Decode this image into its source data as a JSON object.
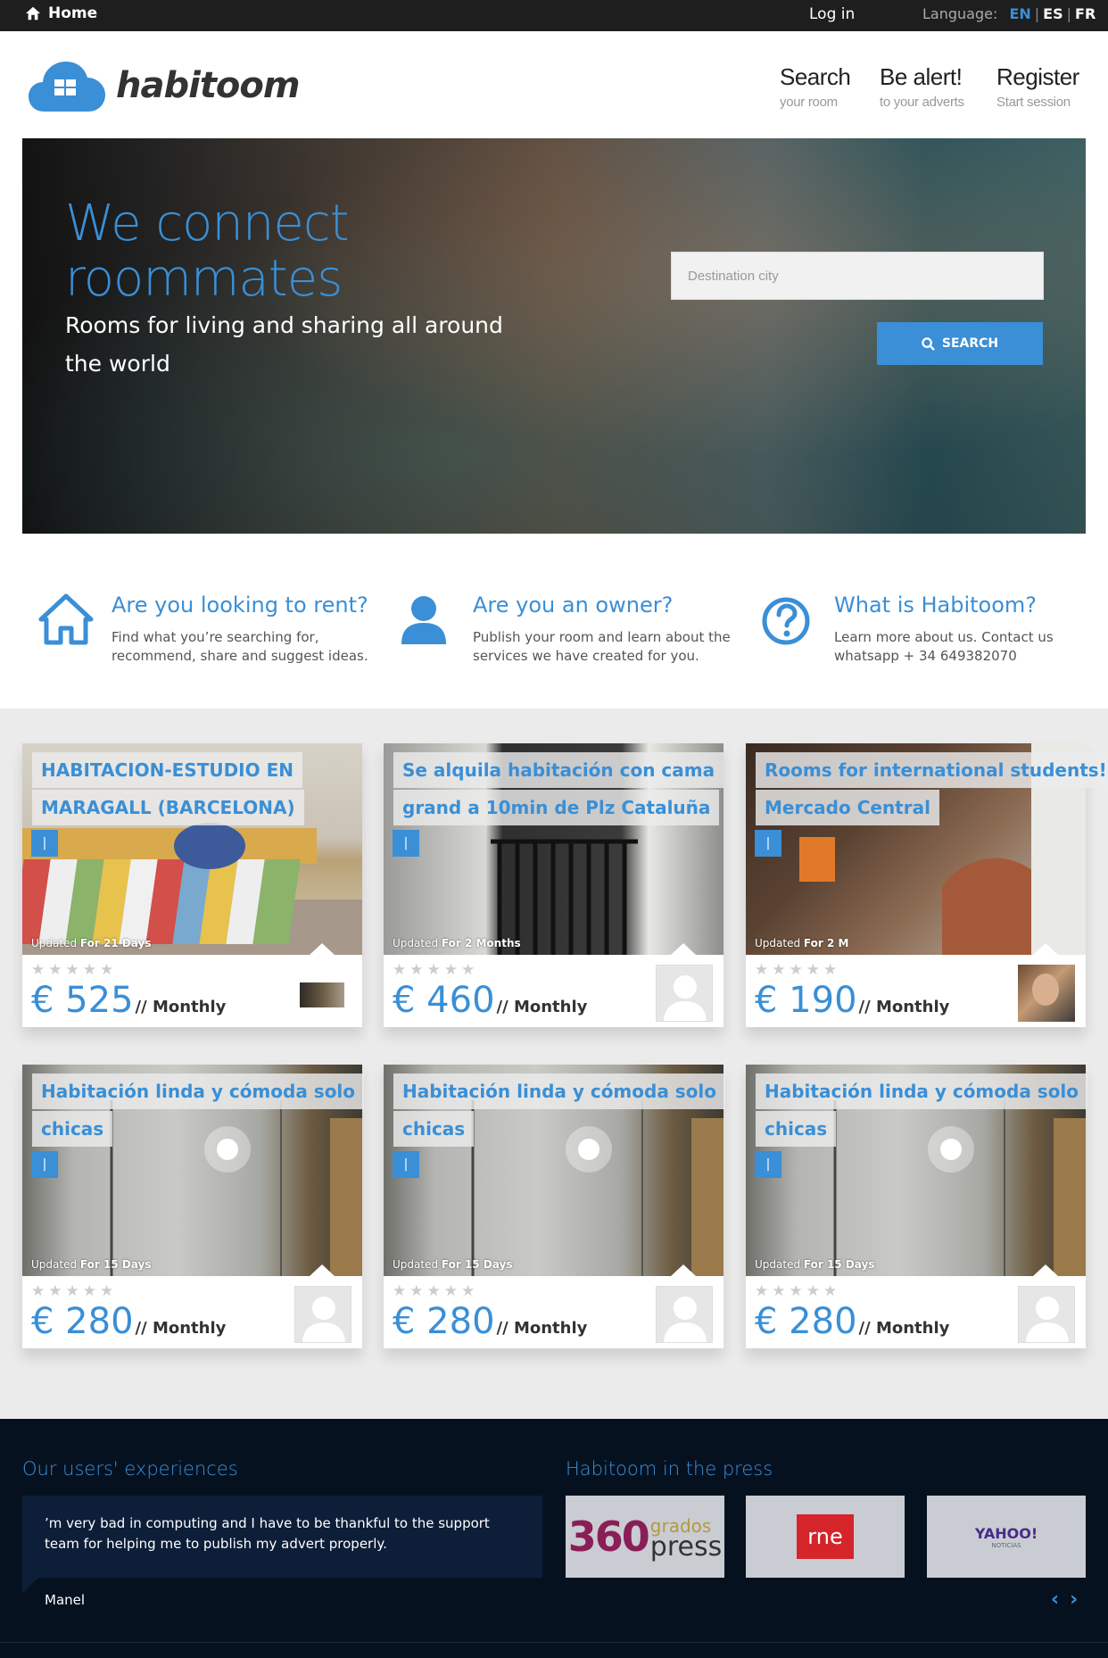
{
  "topbar": {
    "home": "Home",
    "login": "Log in",
    "language_label": "Language:",
    "languages": [
      "EN",
      "ES",
      "FR"
    ],
    "active_language": "EN"
  },
  "header": {
    "brand": "habitoom",
    "nav": [
      {
        "title": "Search",
        "subtitle": "your room"
      },
      {
        "title": "Be alert!",
        "subtitle": "to your adverts"
      },
      {
        "title": "Register",
        "subtitle": "Start session"
      }
    ]
  },
  "hero": {
    "title": "We connect roommates",
    "subtitle": "Rooms for living and sharing all around the world",
    "search_placeholder": "Destination city",
    "search_button": "SEARCH"
  },
  "features": [
    {
      "icon": "house-icon",
      "title": "Are you looking to rent?",
      "text": "Find what you’re searching for, recommend, share and suggest ideas."
    },
    {
      "icon": "user-icon",
      "title": "Are you an owner?",
      "text": "Publish your room and learn about the services we have created for you."
    },
    {
      "icon": "question-icon",
      "title": "What is Habitoom?",
      "text": "Learn more about us. Contact us whatsapp + 34 649382070"
    }
  ],
  "listings": [
    {
      "title_lines": [
        "HABITACION-ESTUDIO EN",
        "MARAGALL (BARCELONA)"
      ],
      "tag": "|",
      "updated_label": "Updated",
      "updated_value": "For 21 Days",
      "currency": "€",
      "price": "525",
      "period": "// Monthly",
      "stars": 5,
      "avatar": "room-thumbnail"
    },
    {
      "title_lines": [
        "Se alquila habitación con cama",
        "grand a 10min de Plz Cataluña"
      ],
      "tag": "|",
      "updated_label": "Updated",
      "updated_value": "For 2 Months",
      "currency": "€",
      "price": "460",
      "period": "// Monthly",
      "stars": 5,
      "avatar": "default-user-icon"
    },
    {
      "title_lines": [
        "Rooms for international students!",
        "Mercado Central"
      ],
      "tag": "|",
      "updated_label": "Updated",
      "updated_value": "For 2 M",
      "currency": "€",
      "price": "190",
      "period": "// Monthly",
      "stars": 5,
      "avatar": "user-photo"
    },
    {
      "title_lines": [
        "Habitación linda y cómoda solo",
        "chicas"
      ],
      "tag": "|",
      "updated_label": "Updated",
      "updated_value": "For 15 Days",
      "currency": "€",
      "price": "280",
      "period": "// Monthly",
      "stars": 5,
      "avatar": "default-user-icon"
    },
    {
      "title_lines": [
        "Habitación linda y cómoda solo",
        "chicas"
      ],
      "tag": "|",
      "updated_label": "Updated",
      "updated_value": "For 15 Days",
      "currency": "€",
      "price": "280",
      "period": "// Monthly",
      "stars": 5,
      "avatar": "default-user-icon"
    },
    {
      "title_lines": [
        "Habitación linda y cómoda solo",
        "chicas"
      ],
      "tag": "|",
      "updated_label": "Updated",
      "updated_value": "For 15 Days",
      "currency": "€",
      "price": "280",
      "period": "// Monthly",
      "stars": 5,
      "avatar": "default-user-icon"
    }
  ],
  "footer": {
    "experiences_title": "Our users' experiences",
    "testimonial": "’m very bad in computing and I have to be thankful to the support team for helping me to publish my advert properly.",
    "author": "Manel",
    "press_title": "Habitoom in the press",
    "press_logos": [
      {
        "name": "360-grados-press-logo",
        "big": "360",
        "small_top": "grados",
        "small_bottom": "press"
      },
      {
        "name": "rne-logo",
        "text": "rne"
      },
      {
        "name": "yahoo-noticias-logo",
        "text": "YAHOO!",
        "sub": "NOTICIAS"
      }
    ],
    "prev": "‹",
    "next": "›"
  },
  "colors": {
    "accent": "#3a8fd6",
    "topbar": "#1e1e1e",
    "footer": "#061120",
    "listing_bg": "#ebebeb"
  }
}
